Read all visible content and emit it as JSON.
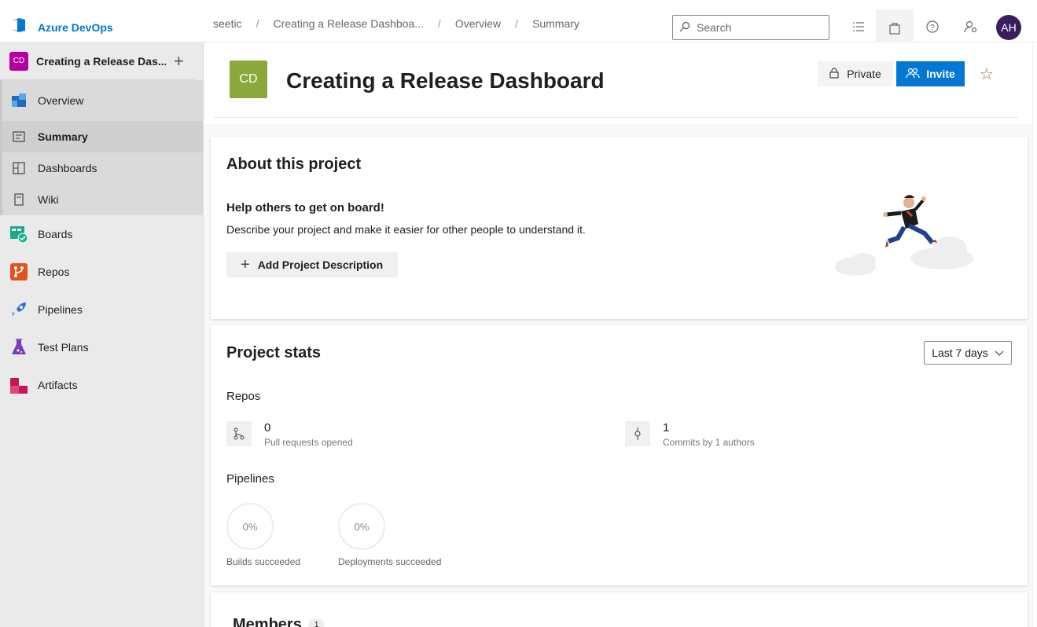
{
  "app": {
    "name": "Azure DevOps"
  },
  "breadcrumb": [
    "seetic",
    "Creating a Release Dashboa...",
    "Overview",
    "Summary"
  ],
  "search": {
    "placeholder": "Search"
  },
  "user": {
    "initials": "AH"
  },
  "sidebar": {
    "project_initials": "CD",
    "project_name": "Creating a Release Das...",
    "items": [
      {
        "label": "Overview",
        "icon": "overview-icon"
      },
      {
        "label": "Summary",
        "icon": "summary-icon"
      },
      {
        "label": "Dashboards",
        "icon": "dashboards-icon"
      },
      {
        "label": "Wiki",
        "icon": "wiki-icon"
      },
      {
        "label": "Boards",
        "icon": "boards-icon"
      },
      {
        "label": "Repos",
        "icon": "repos-icon"
      },
      {
        "label": "Pipelines",
        "icon": "pipelines-icon"
      },
      {
        "label": "Test Plans",
        "icon": "test-plans-icon"
      },
      {
        "label": "Artifacts",
        "icon": "artifacts-icon"
      }
    ]
  },
  "header": {
    "initials": "CD",
    "title": "Creating a Release Dashboard",
    "private_label": "Private",
    "invite_label": "Invite"
  },
  "about": {
    "title": "About this project",
    "help_title": "Help others to get on board!",
    "help_desc": "Describe your project and make it easier for other people to understand it.",
    "add_label": "Add Project Description"
  },
  "stats": {
    "title": "Project stats",
    "range": "Last 7 days",
    "repos_label": "Repos",
    "pull_requests": {
      "value": "0",
      "label": "Pull requests opened"
    },
    "commits": {
      "value": "1",
      "label": "Commits by 1 authors"
    },
    "pipelines_label": "Pipelines",
    "builds": {
      "value": "0%",
      "label": "Builds succeeded"
    },
    "deployments": {
      "value": "0%",
      "label": "Deployments succeeded"
    }
  },
  "members": {
    "title": "Members",
    "count": "1"
  },
  "colors": {
    "accent": "#0078d4",
    "project_badge": "#b4009e",
    "header_tile": "#8aa83b"
  }
}
